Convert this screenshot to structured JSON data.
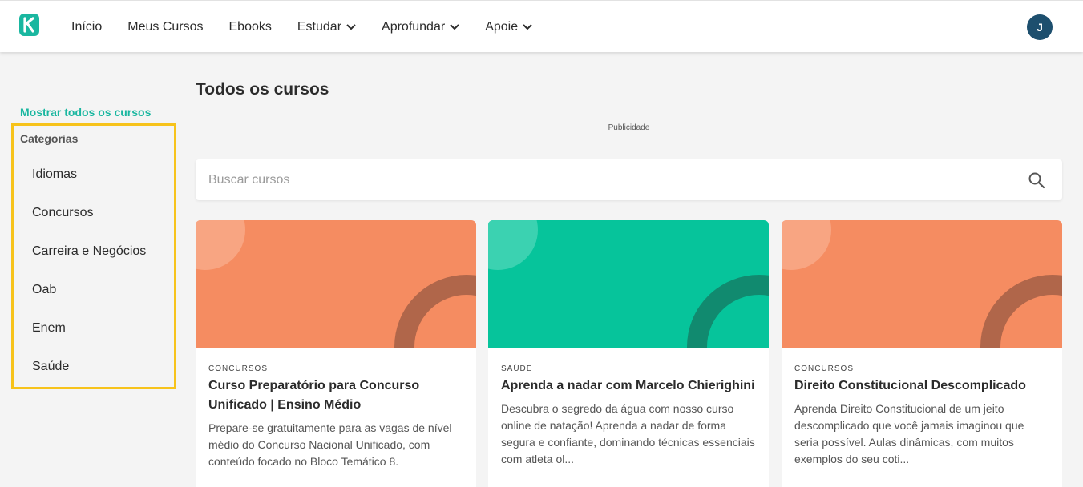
{
  "header": {
    "nav": [
      {
        "label": "Início",
        "dropdown": false
      },
      {
        "label": "Meus Cursos",
        "dropdown": false
      },
      {
        "label": "Ebooks",
        "dropdown": false
      },
      {
        "label": "Estudar",
        "dropdown": true
      },
      {
        "label": "Aprofundar",
        "dropdown": true
      },
      {
        "label": "Apoie",
        "dropdown": true
      }
    ],
    "avatar_initial": "J"
  },
  "sidebar": {
    "show_all": "Mostrar todos os cursos",
    "categories_title": "Categorias",
    "categories": [
      "Idiomas",
      "Concursos",
      "Carreira e Negócios",
      "Oab",
      "Enem",
      "Saúde"
    ]
  },
  "main": {
    "title": "Todos os cursos",
    "ad_label": "Publicidade",
    "search": {
      "placeholder": "Buscar cursos",
      "value": ""
    },
    "cards": [
      {
        "category": "Concursos",
        "title": "Curso Preparatório para Concurso Unificado | Ensino Médio",
        "description": "Prepare-se gratuitamente para as vagas de nível médio do Concurso Nacional Unificado, com conteúdo focado no Bloco Temático 8.",
        "banner_color": "#f58c61",
        "circle_color": "#f8a582",
        "arc_color": "#b0664a"
      },
      {
        "category": "Saúde",
        "title": "Aprenda a nadar com Marcelo Chierighini",
        "description": "Descubra o segredo da água com nosso curso online de natação! Aprenda a nadar de forma segura e confiante, dominando técnicas essenciais com atleta ol...",
        "banner_color": "#06c49b",
        "circle_color": "#3bd2b1",
        "arc_color": "#118a6f"
      },
      {
        "category": "Concursos",
        "title": "Direito Constitucional Descomplicado",
        "description": "Aprenda Direito Constitucional de um jeito descomplicado que você jamais imaginou que seria possível. Aulas dinâmicas, com muitos exemplos do seu coti...",
        "banner_color": "#f58c61",
        "circle_color": "#f8a582",
        "arc_color": "#b0664a"
      }
    ]
  },
  "colors": {
    "accent": "#1ab7a0",
    "highlight_border": "#f7c31b",
    "avatar_bg": "#1d4f6e"
  }
}
